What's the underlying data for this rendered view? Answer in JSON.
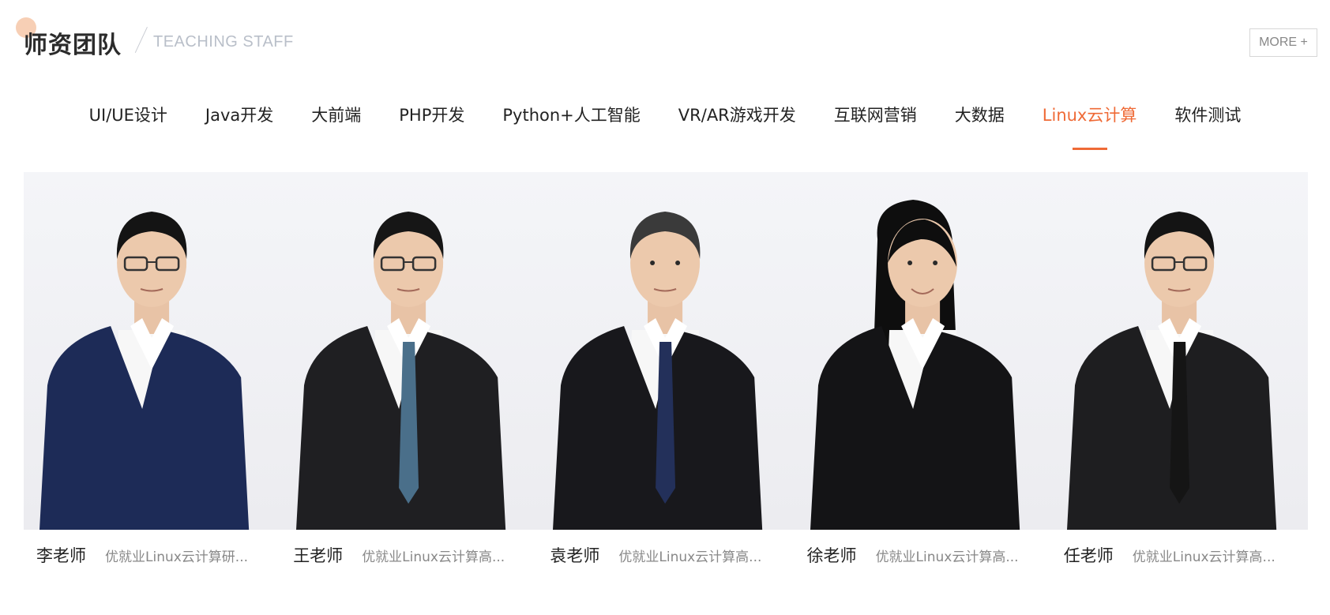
{
  "header": {
    "title": "师资团队",
    "subtitle": "TEACHING STAFF",
    "more_label": "MORE +"
  },
  "tabs": [
    {
      "label": "UI/UE设计",
      "active": false
    },
    {
      "label": "Java开发",
      "active": false
    },
    {
      "label": "大前端",
      "active": false
    },
    {
      "label": "PHP开发",
      "active": false
    },
    {
      "label": "Python+人工智能",
      "active": false
    },
    {
      "label": "VR/AR游戏开发",
      "active": false
    },
    {
      "label": "互联网营销",
      "active": false
    },
    {
      "label": "大数据",
      "active": false
    },
    {
      "label": "Linux云计算",
      "active": true
    },
    {
      "label": "软件测试",
      "active": false
    }
  ],
  "accent_color": "#ef6a36",
  "staff": [
    {
      "name": "李老师",
      "desc": "优就业Linux云计算研...",
      "suit": "#1d2b57",
      "tie": "none",
      "hair": "#141414"
    },
    {
      "name": "王老师",
      "desc": "优就业Linux云计算高...",
      "suit": "#1f1f22",
      "tie": "#4a6f8a",
      "hair": "#161616"
    },
    {
      "name": "袁老师",
      "desc": "优就业Linux云计算高...",
      "suit": "#18181c",
      "tie": "#23305a",
      "hair": "#3a3a3a"
    },
    {
      "name": "徐老师",
      "desc": "优就业Linux云计算高...",
      "suit": "#141416",
      "tie": "none",
      "hair": "#0e0e0e"
    },
    {
      "name": "任老师",
      "desc": "优就业Linux云计算高...",
      "suit": "#1e1e20",
      "tie": "#151515",
      "hair": "#141414"
    }
  ]
}
